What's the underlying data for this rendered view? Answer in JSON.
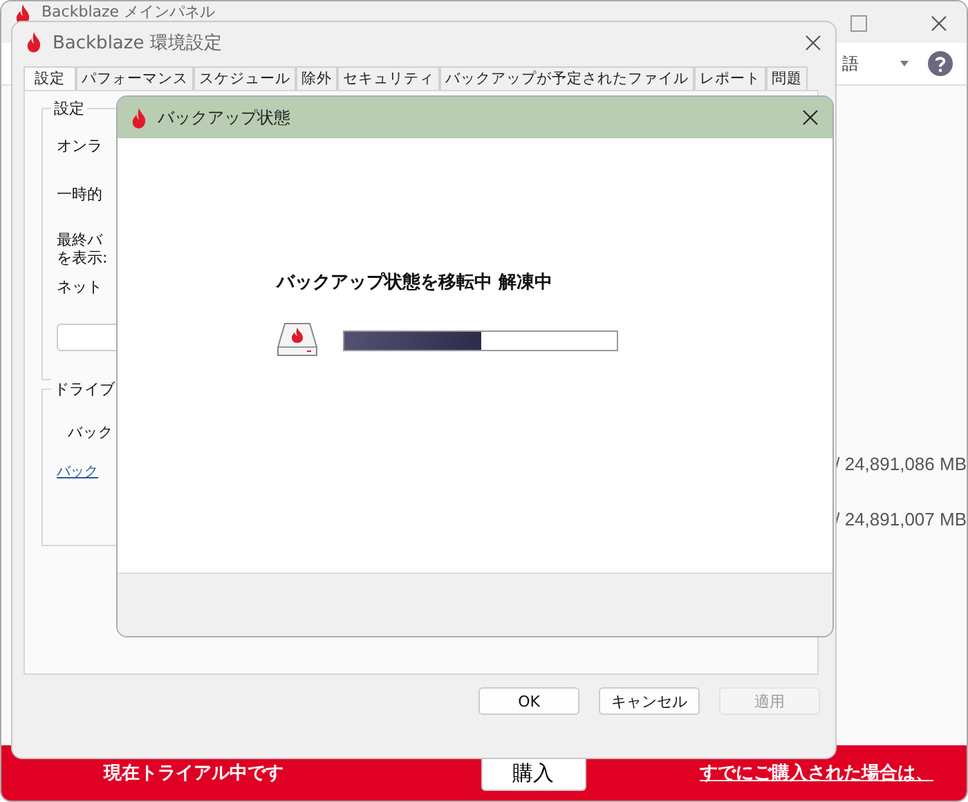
{
  "main_window": {
    "title": "Backblaze メインパネル",
    "language_field": "語",
    "sizes": [
      "/ 24,891,086 MB",
      "/ 24,891,007 MB"
    ],
    "trial_bar": {
      "message": "現在トライアル中です",
      "buy_button": "購入",
      "link": "すでにご購入された場合は、"
    }
  },
  "preferences": {
    "title": "Backblaze 環境設定",
    "tabs": [
      {
        "label": "設定",
        "selected": true
      },
      {
        "label": "パフォーマンス",
        "selected": false
      },
      {
        "label": "スケジュール",
        "selected": false
      },
      {
        "label": "除外",
        "selected": false
      },
      {
        "label": "セキュリティ",
        "selected": false
      },
      {
        "label": "バックアップが予定されたファイル",
        "selected": false
      },
      {
        "label": "レポート",
        "selected": false
      },
      {
        "label": "問題",
        "selected": false
      }
    ],
    "settings_group": {
      "title": "設定",
      "labels": [
        "オンラ",
        "一時的",
        "最終バ",
        "を表示:",
        "ネット"
      ]
    },
    "drive_group": {
      "title": "ドライブ",
      "label": "バック",
      "link": "バック"
    },
    "buttons": [
      {
        "label": "OK",
        "disabled": false
      },
      {
        "label": "キャンセル",
        "disabled": false
      },
      {
        "label": "適用",
        "disabled": true
      }
    ]
  },
  "dialog": {
    "title": "バックアップ状態",
    "message": "バックアップ状態を移転中 解凍中",
    "progress": {
      "level": 0.5
    }
  }
}
